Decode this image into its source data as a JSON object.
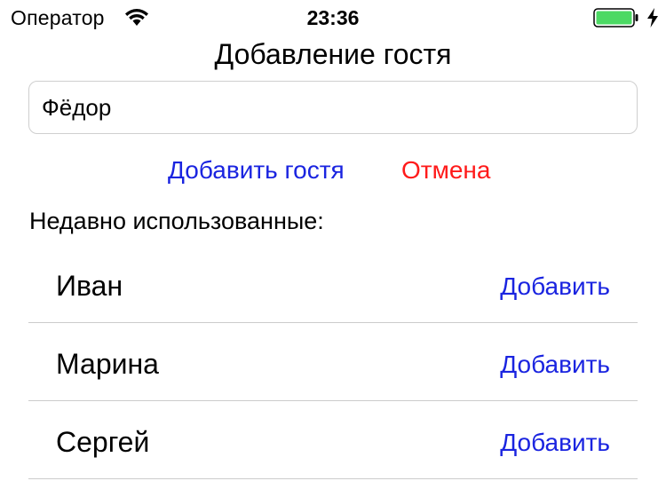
{
  "status_bar": {
    "carrier": "Оператор",
    "time": "23:36",
    "wifi_icon": "wifi-icon",
    "battery_icon": "battery-icon",
    "battery_color": "#4cd964",
    "charging_icon": "bolt-icon"
  },
  "header": {
    "title": "Добавление гостя"
  },
  "form": {
    "name_value": "Фёдор",
    "add_label": "Добавить гостя",
    "cancel_label": "Отмена"
  },
  "recent": {
    "label": "Недавно использованные:",
    "items": [
      {
        "name": "Иван",
        "add_label": "Добавить"
      },
      {
        "name": "Марина",
        "add_label": "Добавить"
      },
      {
        "name": "Сергей",
        "add_label": "Добавить"
      }
    ]
  },
  "colors": {
    "accent": "#1a24e0",
    "destructive": "#ff1a1a"
  }
}
